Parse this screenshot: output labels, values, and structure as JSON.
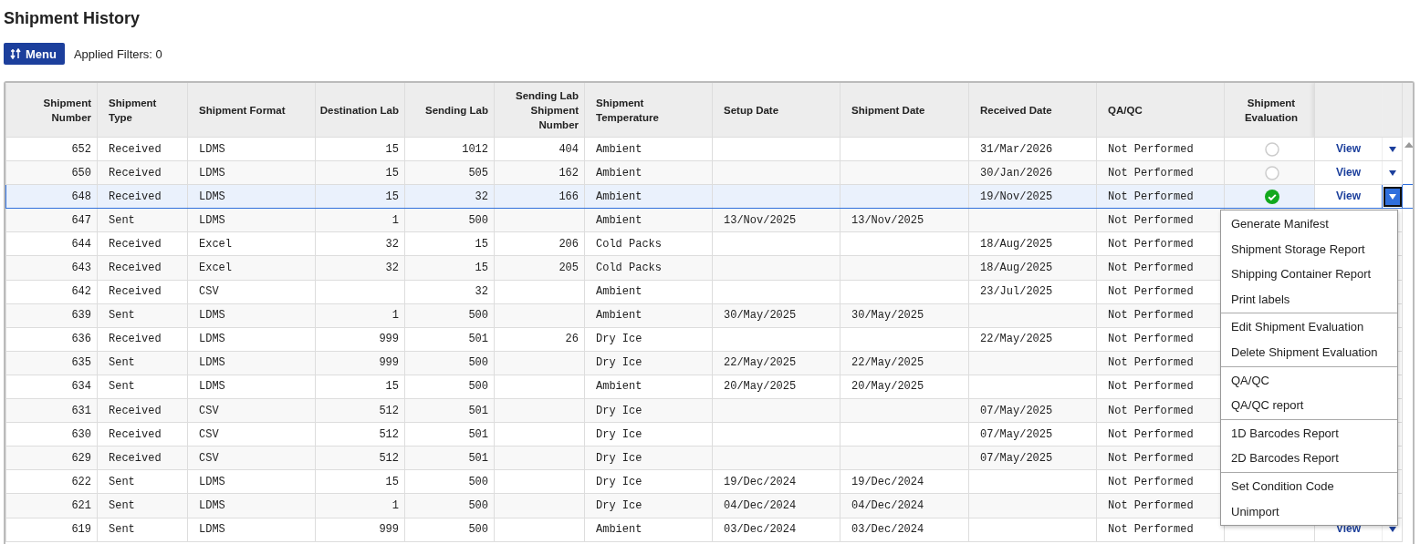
{
  "title": "Shipment History",
  "toolbar": {
    "menu_button": "Menu",
    "filters": "Applied Filters: 0"
  },
  "table": {
    "columns": [
      {
        "label": "Shipment Number",
        "kind": "number"
      },
      {
        "label": "Shipment Type",
        "kind": "text"
      },
      {
        "label": "Shipment Format",
        "kind": "text"
      },
      {
        "label": "Destination Lab",
        "kind": "number"
      },
      {
        "label": "Sending Lab",
        "kind": "number"
      },
      {
        "label": "Sending Lab Shipment Number",
        "kind": "number"
      },
      {
        "label": "Shipment Temperature",
        "kind": "text"
      },
      {
        "label": "Setup Date",
        "kind": "text"
      },
      {
        "label": "Shipment Date",
        "kind": "text"
      },
      {
        "label": "Received Date",
        "kind": "text"
      },
      {
        "label": "QA/QC",
        "kind": "text"
      },
      {
        "label": "Shipment Evaluation",
        "kind": "evaluation"
      }
    ],
    "rows": [
      {
        "cells": [
          "652",
          "Received",
          "LDMS",
          "15",
          "1012",
          "404",
          "Ambient",
          null,
          null,
          "31/Mar/2026",
          "Not Performed"
        ],
        "evaluated": false,
        "action": "View",
        "selected": false
      },
      {
        "cells": [
          "650",
          "Received",
          "LDMS",
          "15",
          "505",
          "162",
          "Ambient",
          null,
          null,
          "30/Jan/2026",
          "Not Performed"
        ],
        "evaluated": false,
        "action": "View",
        "selected": false
      },
      {
        "cells": [
          "648",
          "Received",
          "LDMS",
          "15",
          "32",
          "166",
          "Ambient",
          null,
          null,
          "19/Nov/2025",
          "Not Performed"
        ],
        "evaluated": true,
        "action": "View",
        "selected": true
      },
      {
        "cells": [
          "647",
          "Sent",
          "LDMS",
          "1",
          "500",
          null,
          "Ambient",
          "13/Nov/2025",
          "13/Nov/2025",
          null,
          "Not Performed"
        ],
        "selected": false
      },
      {
        "cells": [
          "644",
          "Received",
          "Excel",
          "32",
          "15",
          "206",
          "Cold Packs",
          null,
          null,
          "18/Aug/2025",
          "Not Performed"
        ],
        "selected": false
      },
      {
        "cells": [
          "643",
          "Received",
          "Excel",
          "32",
          "15",
          "205",
          "Cold Packs",
          null,
          null,
          "18/Aug/2025",
          "Not Performed"
        ],
        "selected": false
      },
      {
        "cells": [
          "642",
          "Received",
          "CSV",
          null,
          "32",
          null,
          "Ambient",
          null,
          null,
          "23/Jul/2025",
          "Not Performed"
        ],
        "selected": false
      },
      {
        "cells": [
          "639",
          "Sent",
          "LDMS",
          "1",
          "500",
          null,
          "Ambient",
          "30/May/2025",
          "30/May/2025",
          null,
          "Not Performed"
        ],
        "selected": false
      },
      {
        "cells": [
          "636",
          "Received",
          "LDMS",
          "999",
          "501",
          "26",
          "Dry Ice",
          null,
          null,
          "22/May/2025",
          "Not Performed"
        ],
        "selected": false
      },
      {
        "cells": [
          "635",
          "Sent",
          "LDMS",
          "999",
          "500",
          null,
          "Dry Ice",
          "22/May/2025",
          "22/May/2025",
          null,
          "Not Performed"
        ],
        "selected": false
      },
      {
        "cells": [
          "634",
          "Sent",
          "LDMS",
          "15",
          "500",
          null,
          "Ambient",
          "20/May/2025",
          "20/May/2025",
          null,
          "Not Performed"
        ],
        "selected": false
      },
      {
        "cells": [
          "631",
          "Received",
          "CSV",
          "512",
          "501",
          null,
          "Dry Ice",
          null,
          null,
          "07/May/2025",
          "Not Performed"
        ],
        "selected": false
      },
      {
        "cells": [
          "630",
          "Received",
          "CSV",
          "512",
          "501",
          null,
          "Dry Ice",
          null,
          null,
          "07/May/2025",
          "Not Performed"
        ],
        "selected": false
      },
      {
        "cells": [
          "629",
          "Received",
          "CSV",
          "512",
          "501",
          null,
          "Dry Ice",
          null,
          null,
          "07/May/2025",
          "Not Performed"
        ],
        "selected": false
      },
      {
        "cells": [
          "622",
          "Sent",
          "LDMS",
          "15",
          "500",
          null,
          "Dry Ice",
          "19/Dec/2024",
          "19/Dec/2024",
          null,
          "Not Performed"
        ],
        "selected": false
      },
      {
        "cells": [
          "621",
          "Sent",
          "LDMS",
          "1",
          "500",
          null,
          "Dry Ice",
          "04/Dec/2024",
          "04/Dec/2024",
          null,
          "Not Performed"
        ],
        "selected": false
      },
      {
        "cells": [
          "619",
          "Sent",
          "LDMS",
          "999",
          "500",
          null,
          "Ambient",
          "03/Dec/2024",
          "03/Dec/2024",
          null,
          "Not Performed"
        ],
        "action": "View",
        "selected": false
      }
    ]
  },
  "context_menu": {
    "groups": [
      [
        "Generate Manifest",
        "Shipment Storage Report",
        "Shipping Container Report",
        "Print labels"
      ],
      [
        "Edit Shipment Evaluation",
        "Delete Shipment Evaluation"
      ],
      [
        "QA/QC",
        "QA/QC report"
      ],
      [
        "1D Barcodes Report",
        "2D Barcodes Report"
      ],
      [
        "Set Condition Code",
        "Unimport"
      ]
    ]
  }
}
